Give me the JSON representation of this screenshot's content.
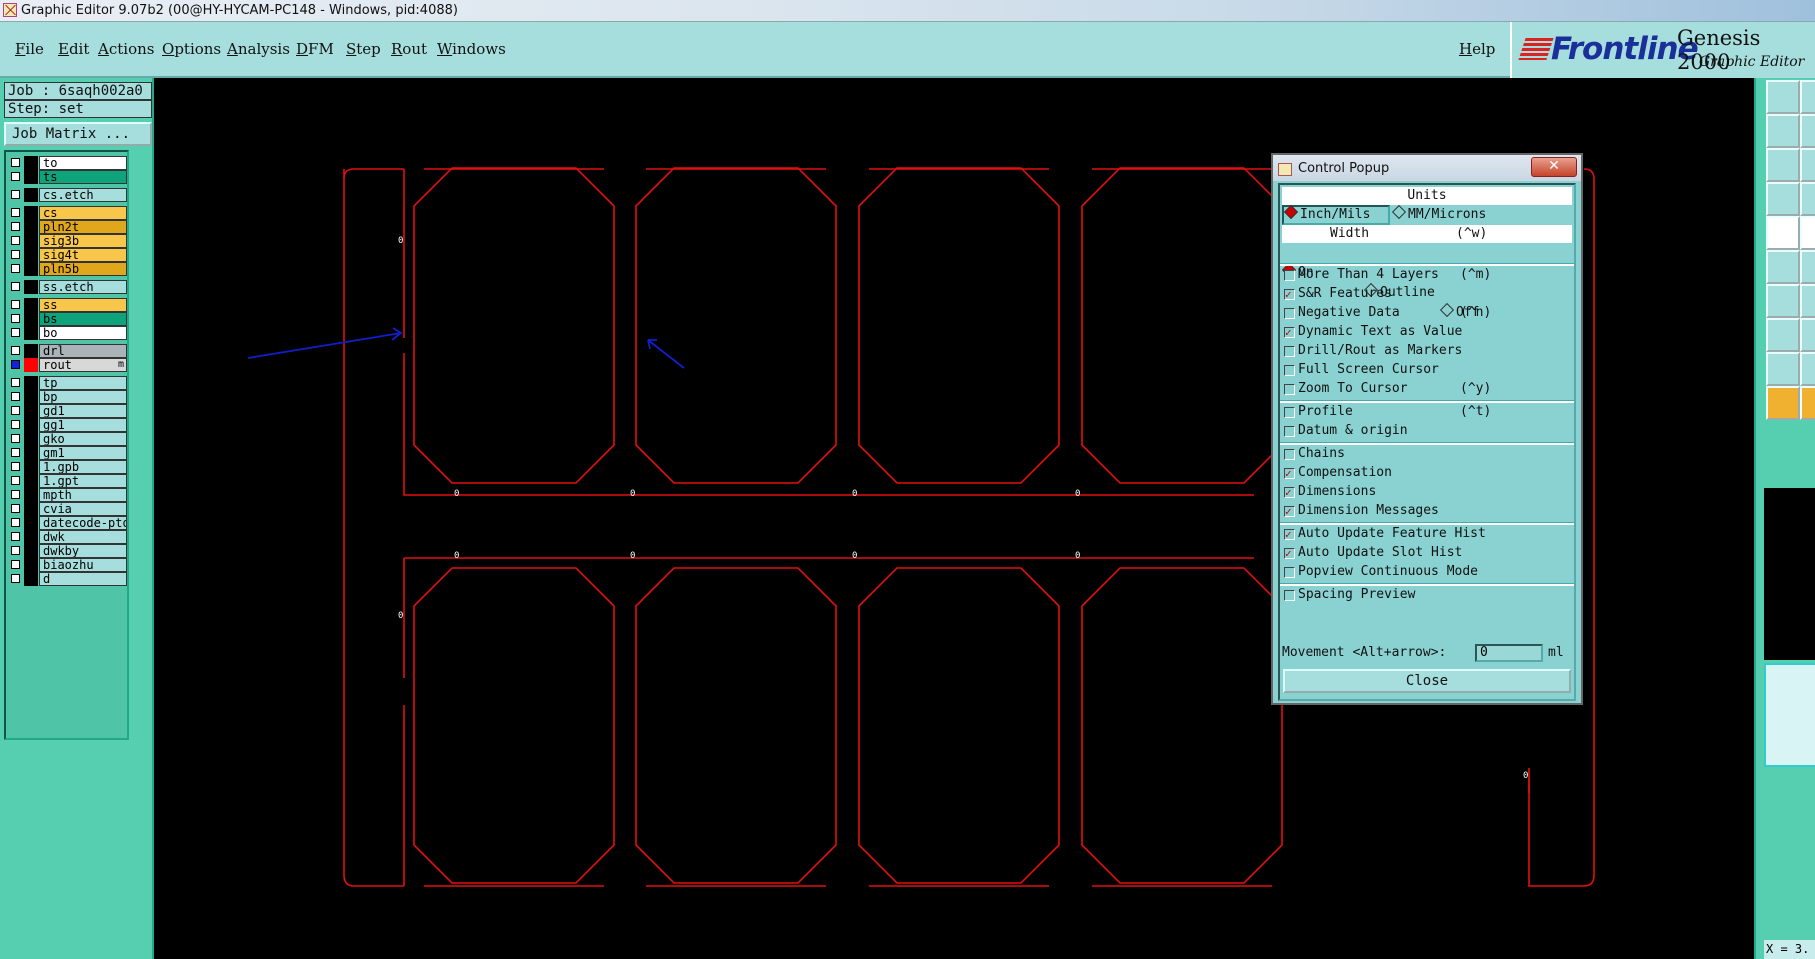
{
  "window": {
    "title": "Graphic Editor 9.07b2 (00@HY-HYCAM-PC148 - Windows, pid:4088)"
  },
  "menu": [
    "File",
    "Edit",
    "Actions",
    "Options",
    "Analysis",
    "DFM",
    "Step",
    "Rout",
    "Windows"
  ],
  "help_label": "Help",
  "brand": {
    "logo": "Frontline",
    "product": "Genesis 2000",
    "subtitle": "Graphic Editor"
  },
  "job": {
    "job_label": "Job : 6saqh002a0",
    "step_label": "Step: set",
    "matrix_button": "Job Matrix ..."
  },
  "layers": [
    {
      "name": "to",
      "color": "#ffffff",
      "swatch": "#000000",
      "selected": false
    },
    {
      "name": "ts",
      "color": "#0fa37c",
      "swatch": "#000000",
      "selected": false
    },
    {
      "name": "cs.etch",
      "color": "#a6dede",
      "swatch": "#000000",
      "selected": false
    },
    {
      "name": "cs",
      "color": "#f7c64a",
      "swatch": "#000000",
      "selected": false
    },
    {
      "name": "pln2t",
      "color": "#e0a61c",
      "swatch": "#000000",
      "selected": false
    },
    {
      "name": "sig3b",
      "color": "#f7c64a",
      "swatch": "#000000",
      "selected": false
    },
    {
      "name": "sig4t",
      "color": "#f7c64a",
      "swatch": "#000000",
      "selected": false
    },
    {
      "name": "pln5b",
      "color": "#e0a61c",
      "swatch": "#000000",
      "selected": false
    },
    {
      "name": "ss.etch",
      "color": "#a6dede",
      "swatch": "#000000",
      "selected": false
    },
    {
      "name": "ss",
      "color": "#f7c64a",
      "swatch": "#000000",
      "selected": false
    },
    {
      "name": "bs",
      "color": "#0fa37c",
      "swatch": "#000000",
      "selected": false
    },
    {
      "name": "bo",
      "color": "#ffffff",
      "swatch": "#000000",
      "selected": false
    },
    {
      "name": "drl",
      "color": "#aab4b8",
      "swatch": "#000000",
      "selected": false
    },
    {
      "name": "rout",
      "color": "#d8d8d8",
      "swatch": "#ff0000",
      "selected": true,
      "mark": "m"
    },
    {
      "name": "tp",
      "color": "#a6dede",
      "swatch": "#000000",
      "selected": false
    },
    {
      "name": "bp",
      "color": "#a6dede",
      "swatch": "#000000",
      "selected": false
    },
    {
      "name": "gd1",
      "color": "#a6dede",
      "swatch": "#000000",
      "selected": false
    },
    {
      "name": "gg1",
      "color": "#a6dede",
      "swatch": "#000000",
      "selected": false
    },
    {
      "name": "gko",
      "color": "#a6dede",
      "swatch": "#000000",
      "selected": false
    },
    {
      "name": "gm1",
      "color": "#a6dede",
      "swatch": "#000000",
      "selected": false
    },
    {
      "name": "1.gpb",
      "color": "#a6dede",
      "swatch": "#000000",
      "selected": false
    },
    {
      "name": "1.gpt",
      "color": "#a6dede",
      "swatch": "#000000",
      "selected": false
    },
    {
      "name": "mpth",
      "color": "#a6dede",
      "swatch": "#000000",
      "selected": false
    },
    {
      "name": "cvia",
      "color": "#a6dede",
      "swatch": "#000000",
      "selected": false
    },
    {
      "name": "datecode-pto",
      "color": "#a6dede",
      "swatch": "#000000",
      "selected": false
    },
    {
      "name": "dwk",
      "color": "#a6dede",
      "swatch": "#000000",
      "selected": false
    },
    {
      "name": "dwkby",
      "color": "#a6dede",
      "swatch": "#000000",
      "selected": false
    },
    {
      "name": "biaozhu",
      "color": "#a6dede",
      "swatch": "#000000",
      "selected": false
    },
    {
      "name": "d",
      "color": "#a6dede",
      "swatch": "#000000",
      "selected": false
    }
  ],
  "canvas": {
    "outline_color": "#e01010",
    "arrow_color": "#1020d0",
    "marker_label": "0"
  },
  "popup": {
    "title": "Control Popup",
    "units_header": "Units",
    "units_options": [
      {
        "label": "Inch/Mils",
        "selected": true
      },
      {
        "label": "MM/Microns",
        "selected": false
      }
    ],
    "width_header": "Width",
    "width_shortcut": "(^w)",
    "width_options": [
      {
        "label": "On",
        "selected": true
      },
      {
        "label": "Outline",
        "selected": false
      },
      {
        "label": "Off",
        "selected": false
      }
    ],
    "groups": [
      [
        {
          "label": "More Than 4 Layers",
          "shortcut": "(^m)",
          "checked": false
        },
        {
          "label": "S&R Features",
          "shortcut": "",
          "checked": true
        },
        {
          "label": "Negative Data",
          "shortcut": "(^n)",
          "checked": false
        },
        {
          "label": "Dynamic Text as Value",
          "shortcut": "",
          "checked": true
        },
        {
          "label": "Drill/Rout as Markers",
          "shortcut": "",
          "checked": false
        },
        {
          "label": "Full Screen Cursor",
          "shortcut": "",
          "checked": false
        },
        {
          "label": "Zoom To Cursor",
          "shortcut": "(^y)",
          "checked": false
        }
      ],
      [
        {
          "label": "Profile",
          "shortcut": "(^t)",
          "checked": false
        },
        {
          "label": "Datum & origin",
          "shortcut": "",
          "checked": false
        }
      ],
      [
        {
          "label": "Chains",
          "shortcut": "",
          "checked": false
        },
        {
          "label": "Compensation",
          "shortcut": "",
          "checked": true
        },
        {
          "label": "Dimensions",
          "shortcut": "",
          "checked": true
        },
        {
          "label": "Dimension Messages",
          "shortcut": "",
          "checked": true
        }
      ],
      [
        {
          "label": "Auto Update Feature Hist",
          "shortcut": "",
          "checked": true
        },
        {
          "label": "Auto Update Slot Hist",
          "shortcut": "",
          "checked": true
        },
        {
          "label": "Popview Continuous Mode",
          "shortcut": "",
          "checked": false
        }
      ],
      [
        {
          "label": "Spacing Preview",
          "shortcut": "",
          "checked": false
        }
      ]
    ],
    "movement_label": "Movement <Alt+arrow>:",
    "movement_value": "0",
    "movement_unit": "ml",
    "close_label": "Close"
  },
  "status": {
    "x_readout": "X = 3."
  }
}
